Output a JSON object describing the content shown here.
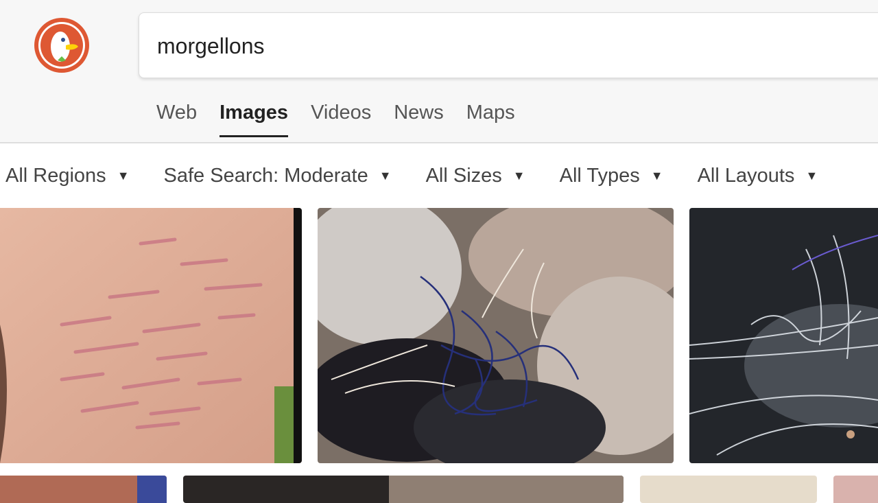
{
  "search": {
    "query": "morgellons"
  },
  "tabs": [
    {
      "label": "Web",
      "active": false
    },
    {
      "label": "Images",
      "active": true
    },
    {
      "label": "Videos",
      "active": false
    },
    {
      "label": "News",
      "active": false
    },
    {
      "label": "Maps",
      "active": false
    }
  ],
  "filters": [
    {
      "label": "All Regions",
      "icon": "caret-down-icon"
    },
    {
      "label": "Safe Search: Moderate",
      "icon": "caret-down-icon"
    },
    {
      "label": "All Sizes",
      "icon": "caret-down-icon"
    },
    {
      "label": "All Types",
      "icon": "caret-down-icon"
    },
    {
      "label": "All Layouts",
      "icon": "caret-down-icon"
    }
  ],
  "icons": {
    "logo": "duckduckgo-logo-icon",
    "caret": "▼"
  },
  "colors": {
    "header_bg": "#f7f7f7",
    "logo_red": "#de5833",
    "active_underline": "#222222"
  }
}
